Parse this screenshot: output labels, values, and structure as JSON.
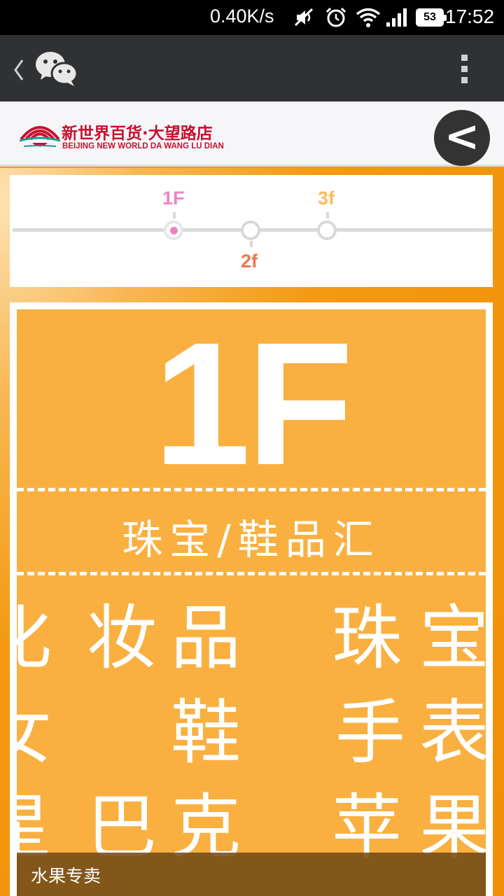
{
  "status_bar": {
    "net_speed": "0.40K/s",
    "battery": "53",
    "time": "17:52"
  },
  "top_bar": {
    "back_icon": "chevron-left-icon",
    "app_icon": "wechat-icon",
    "menu_icon": "more-vertical-icon"
  },
  "store": {
    "name_cn": "新世界百货·大望路店",
    "name_en": "BEIJING NEW WORLD DA WANG LU DIAN",
    "brand_color": "#c8102e",
    "back_button_label": "<"
  },
  "floor_nav": {
    "floors": [
      {
        "label": "1F",
        "color": "#ea85c4",
        "active": true
      },
      {
        "label": "2f",
        "color": "#f2754e",
        "active": false
      },
      {
        "label": "3f",
        "color": "#fbbd57",
        "active": false
      }
    ]
  },
  "floor_panel": {
    "floor": "1F",
    "category": "珠宝/鞋品汇",
    "rows": [
      [
        "化",
        "妆",
        "品",
        "珠",
        "宝"
      ],
      [
        "女",
        "鞋",
        "手",
        "表"
      ],
      [
        "星",
        "巴",
        "克",
        "苹",
        "果"
      ]
    ],
    "caption": "水果专卖",
    "panel_color": "#f9b041"
  }
}
